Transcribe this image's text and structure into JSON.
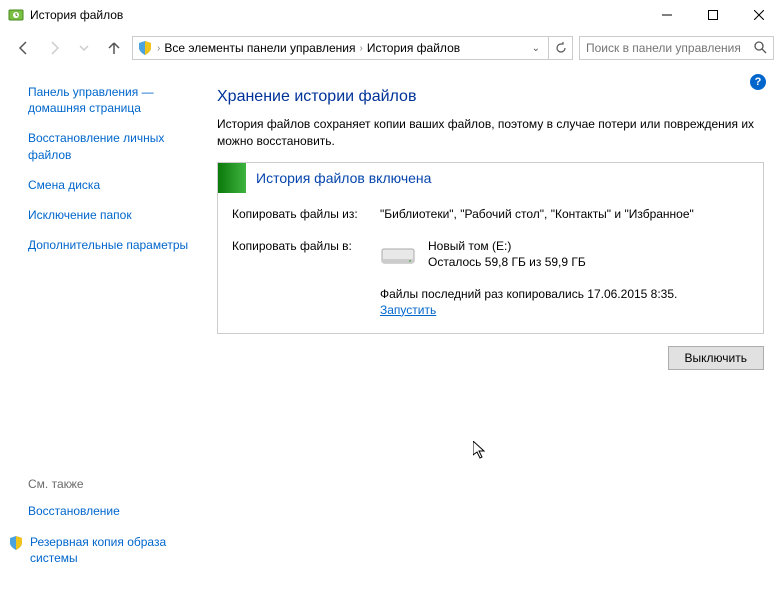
{
  "window": {
    "title": "История файлов"
  },
  "nav": {
    "crumb1": "Все элементы панели управления",
    "crumb2": "История файлов",
    "search_placeholder": "Поиск в панели управления"
  },
  "sidebar": {
    "links": [
      "Панель управления — домашняя страница",
      "Восстановление личных файлов",
      "Смена диска",
      "Исключение папок",
      "Дополнительные параметры"
    ],
    "seealso_title": "См. также",
    "seealso_links": [
      "Восстановление",
      "Резервная копия образа системы"
    ]
  },
  "main": {
    "heading": "Хранение истории файлов",
    "description": "История файлов сохраняет копии ваших файлов, поэтому в случае потери или повреждения их можно восстановить.",
    "status": "История файлов включена",
    "copy_from_label": "Копировать файлы из:",
    "copy_from_value": "\"Библиотеки\", \"Рабочий стол\", \"Контакты\" и \"Избранное\"",
    "copy_to_label": "Копировать файлы в:",
    "drive_name": "Новый том (E:)",
    "drive_space": "Осталось 59,8 ГБ из 59,9 ГБ",
    "last_copy": "Файлы последний раз копировались 17.06.2015 8:35.",
    "run_link": "Запустить",
    "turn_off": "Выключить"
  },
  "help": "?"
}
